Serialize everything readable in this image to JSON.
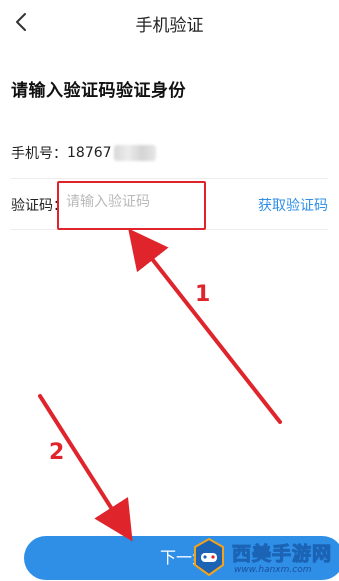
{
  "header": {
    "title": "手机验证",
    "back_icon": "chevron-left-icon"
  },
  "form": {
    "heading": "请输入验证码验证身份",
    "phone_label": "手机号：",
    "phone_value": "18767",
    "code_label": "验证码：",
    "code_placeholder": "请输入验证码",
    "code_value": "",
    "get_code_label": "获取验证码"
  },
  "footer": {
    "next_button_label": "下一步"
  },
  "annotations": {
    "step1": "1",
    "step2": "2"
  },
  "watermark": {
    "text": "西美手游网",
    "url": "www.hanxm.com"
  },
  "colors": {
    "accent": "#2f8fe6",
    "annotation": "#e0242c",
    "text": "#222222"
  }
}
